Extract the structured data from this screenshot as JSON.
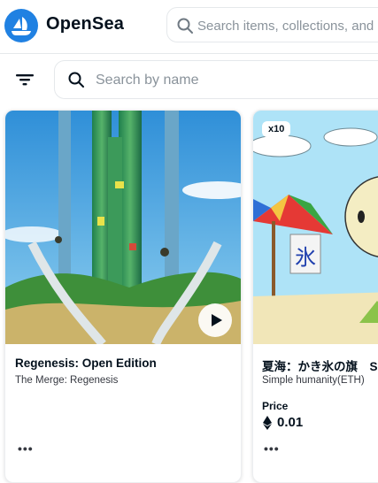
{
  "header": {
    "brand": "OpenSea",
    "search_placeholder": "Search items, collections, and accounts"
  },
  "toolbar": {
    "search_placeholder": "Search by name"
  },
  "cards": [
    {
      "title": "Regenesis: Open Edition",
      "collection": "The Merge: Regenesis",
      "more": "•••"
    },
    {
      "badge": "x10",
      "title": "夏海：かき氷の旗　Su",
      "collection": "Simple humanity(ETH)",
      "price_label": "Price",
      "price_value": "0.01",
      "banner_char": "氷",
      "more": "•••"
    }
  ],
  "colors": {
    "brand_blue": "#2081e2",
    "border": "#e5e8eb",
    "text_primary": "#04111d",
    "text_secondary": "#353840",
    "placeholder": "#8a939b"
  }
}
